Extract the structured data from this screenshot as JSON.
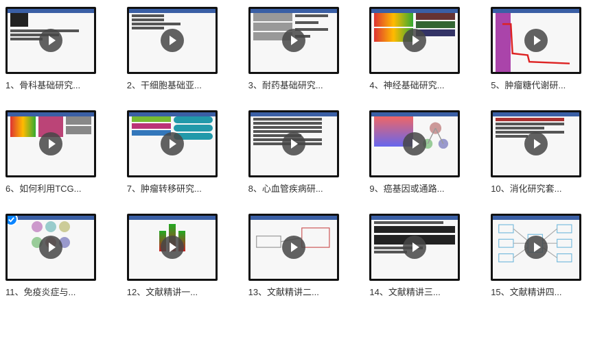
{
  "items": [
    {
      "label": "1、骨科基础研究...",
      "selected": false
    },
    {
      "label": "2、干细胞基础亚...",
      "selected": false
    },
    {
      "label": "3、耐药基础研究...",
      "selected": false
    },
    {
      "label": "4、神经基础研究...",
      "selected": false
    },
    {
      "label": "5、肿瘤糖代谢研...",
      "selected": false
    },
    {
      "label": "6、如何利用TCG...",
      "selected": false
    },
    {
      "label": "7、肿瘤转移研究...",
      "selected": false
    },
    {
      "label": "8、心血管疾病研...",
      "selected": false
    },
    {
      "label": "9、癌基因或通路...",
      "selected": false
    },
    {
      "label": "10、消化研究套...",
      "selected": false
    },
    {
      "label": "11、免疫炎症与...",
      "selected": true
    },
    {
      "label": "12、文献精讲一...",
      "selected": false
    },
    {
      "label": "13、文献精讲二...",
      "selected": false
    },
    {
      "label": "14、文献精讲三...",
      "selected": false
    },
    {
      "label": "15、文献精讲四...",
      "selected": false
    }
  ],
  "icons": {
    "play": "play-icon",
    "check": "check-icon"
  }
}
